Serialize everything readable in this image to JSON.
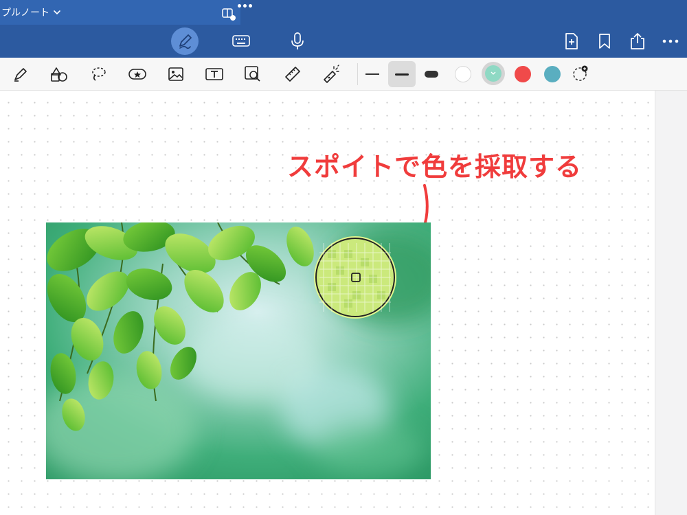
{
  "app": {
    "document_title": "プルノート",
    "annotation_text": "スポイトで色を採取する"
  },
  "topbar": {
    "modes": [
      {
        "name": "pen",
        "icon": "pen-icon",
        "selected": true
      },
      {
        "name": "keyboard",
        "icon": "keyboard-icon",
        "selected": false
      },
      {
        "name": "microphone",
        "icon": "microphone-icon",
        "selected": false
      }
    ],
    "actions": [
      "add-page-icon",
      "bookmark-icon",
      "share-icon",
      "more-icon"
    ]
  },
  "toolbar": {
    "tools": [
      "highlighter-icon",
      "shapes-icon",
      "lasso-icon",
      "sticker-icon",
      "image-icon",
      "text-box-icon",
      "image-search-icon",
      "ruler-icon",
      "laser-pointer-icon"
    ],
    "stroke_widths": [
      "thin",
      "medium",
      "thick"
    ],
    "selected_stroke": "medium",
    "colors": [
      "#ffffff",
      "#8fd9c4",
      "#f04a4a",
      "#5aaec0"
    ],
    "selected_color": "#8fd9c4",
    "accent": "#2c5aa0",
    "annotation_color": "#f03c3c"
  }
}
